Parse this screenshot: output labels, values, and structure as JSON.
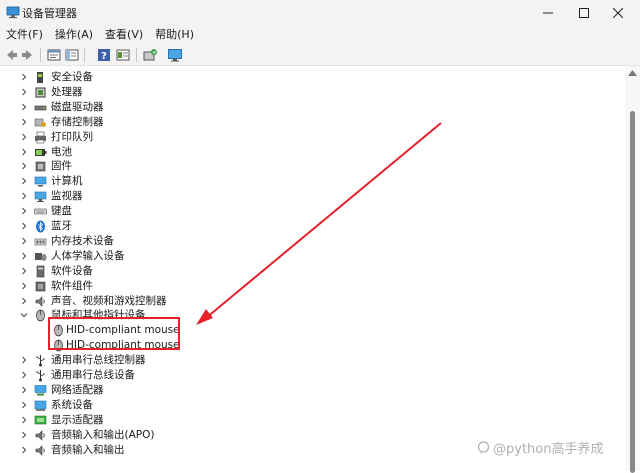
{
  "window": {
    "title": "设备管理器"
  },
  "menu": [
    "文件(F)",
    "操作(A)",
    "查看(V)",
    "帮助(H)"
  ],
  "toolbar_icons": [
    "back-icon",
    "forward-icon",
    "properties-icon",
    "show-hide-icon",
    "help-icon",
    "details-icon",
    "update-driver-icon",
    "monitor-icon"
  ],
  "tree": {
    "items": [
      {
        "label": "安全设备",
        "icon": "security-device-icon"
      },
      {
        "label": "处理器",
        "icon": "processor-icon"
      },
      {
        "label": "磁盘驱动器",
        "icon": "disk-drive-icon"
      },
      {
        "label": "存储控制器",
        "icon": "storage-controller-icon"
      },
      {
        "label": "打印队列",
        "icon": "printer-icon"
      },
      {
        "label": "电池",
        "icon": "battery-icon"
      },
      {
        "label": "固件",
        "icon": "firmware-icon"
      },
      {
        "label": "计算机",
        "icon": "computer-icon"
      },
      {
        "label": "监视器",
        "icon": "monitor-icon"
      },
      {
        "label": "键盘",
        "icon": "keyboard-icon"
      },
      {
        "label": "蓝牙",
        "icon": "bluetooth-icon"
      },
      {
        "label": "内存技术设备",
        "icon": "memory-device-icon"
      },
      {
        "label": "人体学输入设备",
        "icon": "hid-icon"
      },
      {
        "label": "软件设备",
        "icon": "software-device-icon"
      },
      {
        "label": "软件组件",
        "icon": "software-component-icon"
      },
      {
        "label": "声音、视频和游戏控制器",
        "icon": "sound-icon"
      },
      {
        "label": "鼠标和其他指针设备",
        "icon": "mouse-icon",
        "expanded": true
      },
      {
        "label": "HID-compliant mouse",
        "icon": "mouse-icon",
        "child": true
      },
      {
        "label": "HID-compliant mouse",
        "icon": "mouse-icon",
        "child": true
      },
      {
        "label": "通用串行总线控制器",
        "icon": "usb-controller-icon"
      },
      {
        "label": "通用串行总线设备",
        "icon": "usb-device-icon"
      },
      {
        "label": "网络适配器",
        "icon": "network-adapter-icon"
      },
      {
        "label": "系统设备",
        "icon": "system-device-icon"
      },
      {
        "label": "显示适配器",
        "icon": "display-adapter-icon"
      },
      {
        "label": "音频输入和输出(APO)",
        "icon": "audio-io-icon"
      },
      {
        "label": "音频输入和输出",
        "icon": "audio-io-icon"
      }
    ]
  },
  "watermark": "@python高手养成",
  "colors": {
    "annotation": "#e8202a",
    "accent": "#0078d4"
  }
}
